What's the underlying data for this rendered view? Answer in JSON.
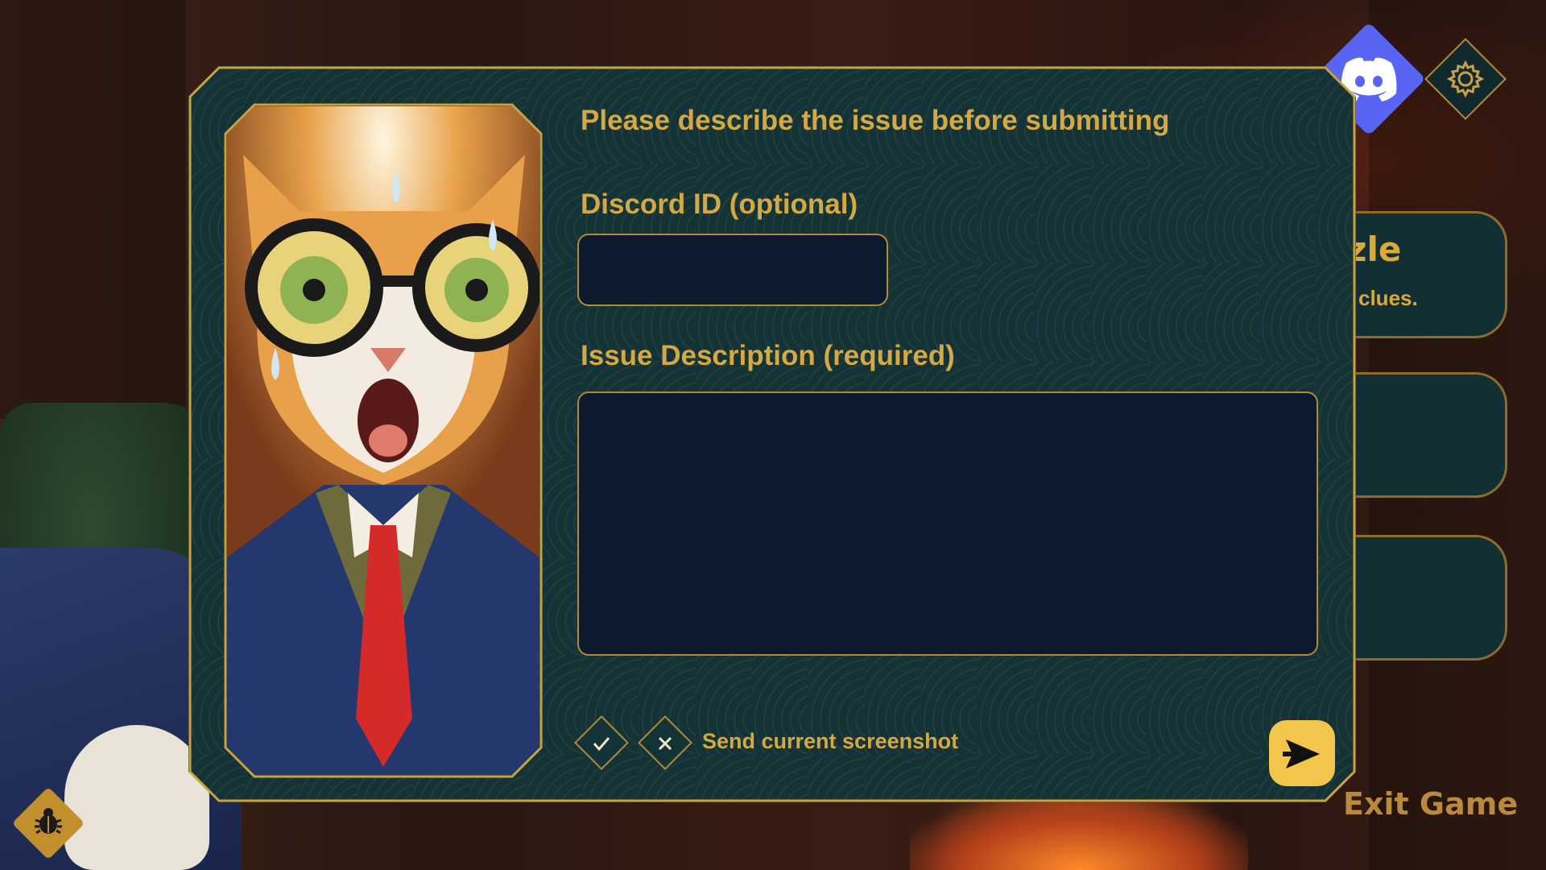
{
  "modal": {
    "headline": "Please describe the issue before submitting",
    "discord_label": "Discord ID (optional)",
    "discord_value": "",
    "issue_label": "Issue Description (required)",
    "issue_value": "",
    "screenshot_label": "Send current screenshot"
  },
  "side_menu": {
    "card1_title": "zle",
    "card1_sub": "clues.",
    "exit_label": "Exit Game"
  },
  "icons": {
    "discord": "discord-icon",
    "settings": "gear-icon",
    "bug": "bug-icon",
    "send": "send-arrow-icon",
    "check": "check-icon",
    "cross": "close-icon"
  },
  "colors": {
    "gold": "#d4a842",
    "panel": "#133338",
    "field": "#0b1a2c",
    "discord": "#5865f2",
    "send": "#f2c64a"
  }
}
